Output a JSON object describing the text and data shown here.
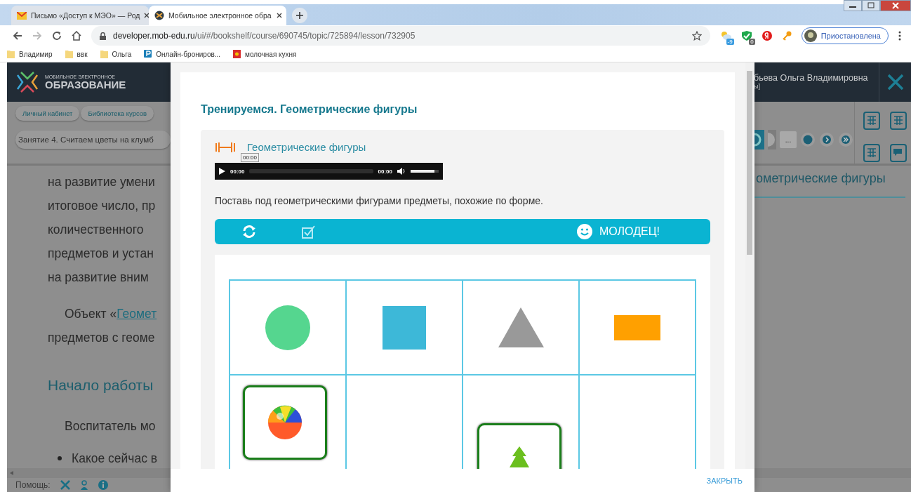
{
  "browser": {
    "tabs": [
      {
        "title": "Письмо «Доступ к МЭО» — Род",
        "selected": false,
        "kind": "mail"
      },
      {
        "title": "Мобильное электронное обра",
        "selected": true,
        "kind": "site"
      }
    ],
    "address": {
      "host": "developer.mob-edu.ru",
      "path": "/ui/#/bookshelf/course/690745/topic/725894/lesson/732905"
    },
    "extension_badges": [
      "-9",
      "0"
    ],
    "profile": {
      "label": "Приостановлена"
    },
    "bookmarks": [
      {
        "label": "Владимир",
        "kind": "folder"
      },
      {
        "label": "ввк",
        "kind": "folder"
      },
      {
        "label": "Ольга",
        "kind": "folder"
      },
      {
        "label": "Онлайн-брониров...",
        "kind": "booking"
      },
      {
        "label": "молочная кухня",
        "kind": "emblem"
      }
    ]
  },
  "app": {
    "logo": {
      "small": "МОБИЛЬНОЕ ЭЛЕКТРОННОЕ",
      "big": "ОБРАЗОВАНИЕ"
    },
    "user": {
      "name": "бьева Ольга Владимировна",
      "role": "ы]"
    },
    "breadcrumbs": [
      "Личный кабинет",
      "Библиотека курсов"
    ],
    "lesson_title": "Занятие 4. Считаем цветы на клумб",
    "pagination": [
      {
        "kind": "current"
      },
      {
        "kind": "page"
      },
      {
        "kind": "ellipsis",
        "label": "..."
      },
      {
        "kind": "dot"
      },
      {
        "kind": "next"
      },
      {
        "kind": "last"
      }
    ],
    "section_heading": "ометрические фигуры",
    "content": [
      {
        "kind": "line",
        "text": "на развитие умени"
      },
      {
        "kind": "line",
        "text": "итоговое число, пр"
      },
      {
        "kind": "line",
        "text": "количественного"
      },
      {
        "kind": "line",
        "text": "предметов и устан"
      },
      {
        "kind": "line",
        "text": "на развитие вним"
      },
      {
        "kind": "link_line",
        "text": "Объект «",
        "link": "Геомет"
      },
      {
        "kind": "line",
        "text": "предметов с геоме"
      },
      {
        "kind": "heading",
        "text": "Начало работы"
      },
      {
        "kind": "indent",
        "text": "Воспитатель мо"
      },
      {
        "kind": "bullet",
        "text": "Какое сейчас в"
      }
    ],
    "help": {
      "label": "Помощь:"
    }
  },
  "modal": {
    "title": "Тренируемся. Геометрические фигуры",
    "exercise_title": "Геометрические фигуры",
    "audio": {
      "tooltip": "00:00",
      "current": "00:00",
      "duration": "00:00",
      "volume": {
        "level": 0.85
      }
    },
    "instruction": "Поставь под геометрическими фигурами предметы, похожие по форме.",
    "feedback": "МОЛОДЕЦ!",
    "shapes": [
      {
        "kind": "circle",
        "color": "#55d68f"
      },
      {
        "kind": "square",
        "color": "#3db8d8"
      },
      {
        "kind": "triangle",
        "color": "#999999"
      },
      {
        "kind": "rectangle",
        "color": "#ffa000"
      }
    ],
    "answers": [
      {
        "kind": "ball"
      },
      {
        "kind": "empty"
      },
      {
        "kind": "tree"
      },
      {
        "kind": "empty"
      }
    ],
    "close": "ЗАКРЫТЬ"
  }
}
